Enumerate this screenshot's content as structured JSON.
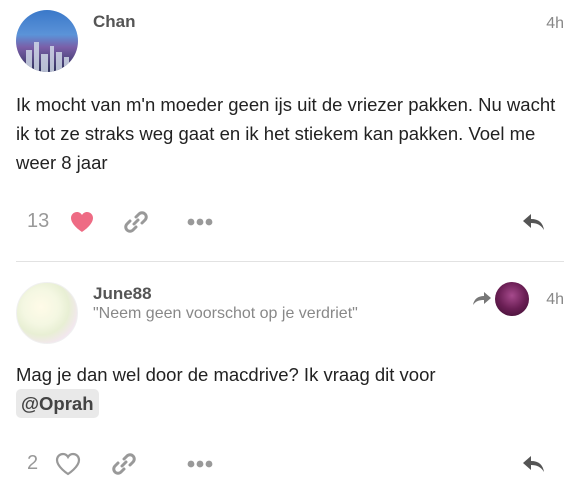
{
  "posts": [
    {
      "username": "Chan",
      "time": "4h",
      "body": "Ik mocht van m'n moeder geen ijs uit de vriezer pakken. Nu wacht ik tot ze straks weg gaat en ik het stiekem kan pakken. Voel me weer 8 jaar",
      "like_count": "13",
      "liked": true
    },
    {
      "username": "June88",
      "subtitle": "\"Neem geen voorschot op je verdriet\"",
      "time": "4h",
      "body": "Mag je dan wel door de macdrive? Ik vraag dit voor",
      "mention": "@Oprah",
      "like_count": "2",
      "liked": false
    }
  ],
  "icons": {
    "like": "heart-icon",
    "link": "link-icon",
    "more": "more-icon",
    "reply": "reply-icon"
  },
  "colors": {
    "liked_heart": "#ee6b84",
    "muted": "#999999"
  }
}
